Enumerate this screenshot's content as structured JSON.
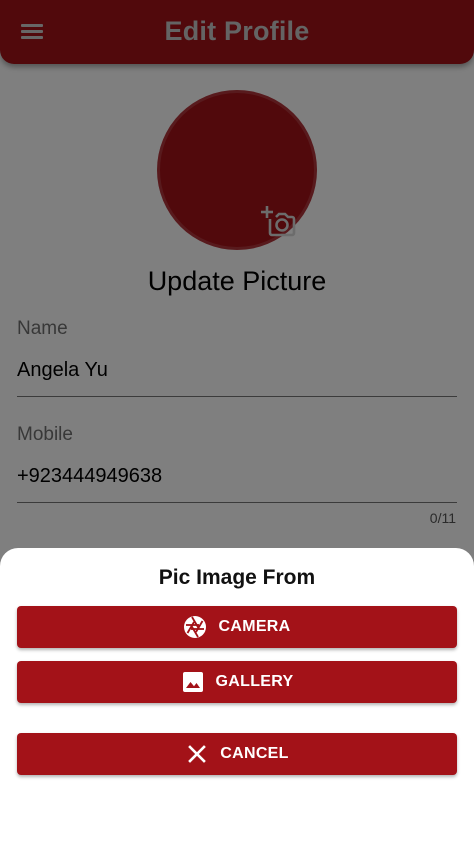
{
  "app_bar": {
    "menu_icon": "menu-icon",
    "title": "Edit Profile"
  },
  "profile": {
    "avatar_icon": "add-photo-icon",
    "update_picture_label": "Update Picture"
  },
  "fields": {
    "name": {
      "label": "Name",
      "value": "Angela Yu"
    },
    "mobile": {
      "label": "Mobile",
      "value": "+923444949638",
      "counter": "0/11"
    }
  },
  "bottom_sheet": {
    "title": "Pic Image From",
    "buttons": {
      "camera": {
        "label": "CAMERA",
        "icon": "camera-shutter-icon"
      },
      "gallery": {
        "label": "GALLERY",
        "icon": "image-icon"
      },
      "cancel": {
        "label": "CANCEL",
        "icon": "close-icon"
      }
    }
  },
  "colors": {
    "primary": "#a31218",
    "scrim": "rgba(0,0,0,0.5)"
  }
}
